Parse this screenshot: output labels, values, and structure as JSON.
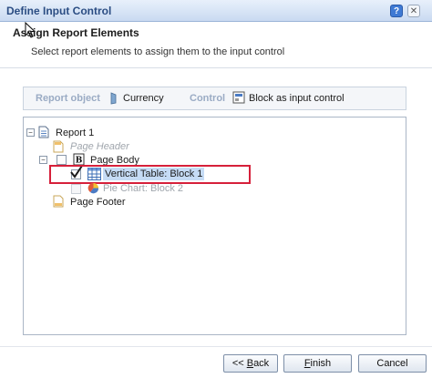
{
  "window": {
    "title": "Define Input Control"
  },
  "header": {
    "title": "Assign Report Elements",
    "subtitle": "Select report elements to assign them to the input control"
  },
  "infobar": {
    "report_object_label": "Report object",
    "report_object_value": "Currency",
    "control_label": "Control",
    "control_value": "Block as input control"
  },
  "tree": {
    "report": "Report 1",
    "page_header": "Page Header",
    "page_body": "Page Body",
    "vertical_table": "Vertical Table: Block 1",
    "pie_chart": "Pie Chart: Block 2",
    "page_footer": "Page Footer",
    "vertical_table_checked": true
  },
  "buttons": {
    "back_prefix": "<< ",
    "back_key": "B",
    "back_rest": "ack",
    "finish_key": "F",
    "finish_rest": "inish",
    "cancel": "Cancel"
  },
  "colors": {
    "accent": "#2b4d83",
    "highlight_border": "#d6203a",
    "selection": "#c5dbf5"
  }
}
